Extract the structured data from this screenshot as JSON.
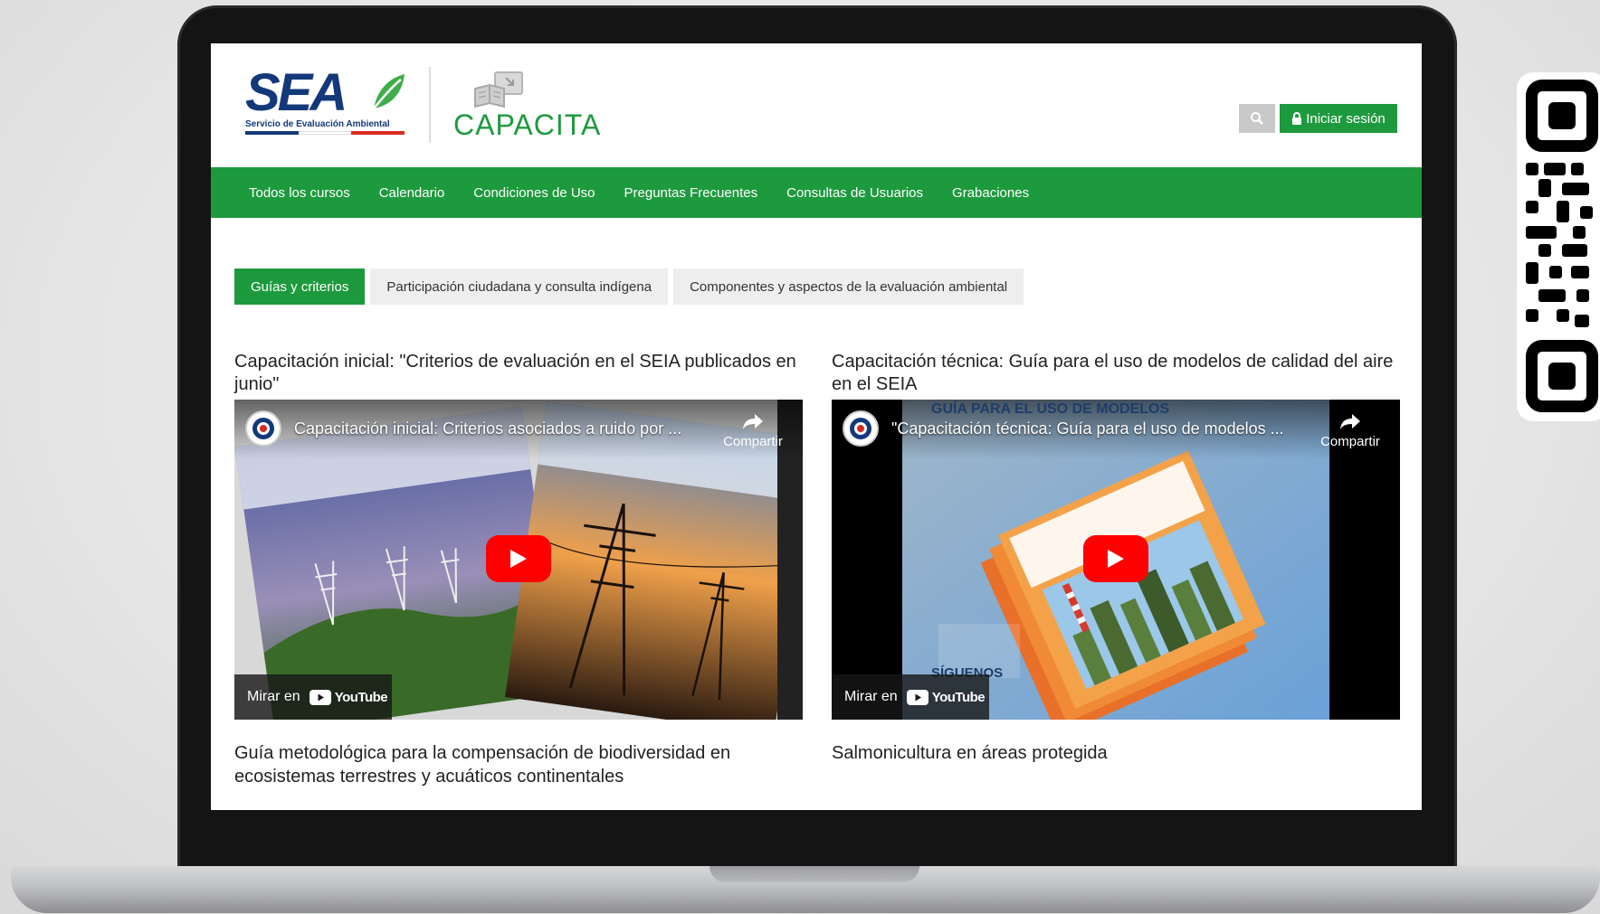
{
  "header": {
    "sea_logo_text": "SEA",
    "sea_subtitle": "Servicio de Evaluación Ambiental",
    "sea_stripe_colors": [
      "#13397a",
      "#ffffff",
      "#d52b1e"
    ],
    "app_name": "CAPACITA",
    "search_icon": "search-icon",
    "login_label": "Iniciar sesión",
    "login_icon": "lock-icon"
  },
  "nav": {
    "items": [
      {
        "label": "Todos los cursos"
      },
      {
        "label": "Calendario"
      },
      {
        "label": "Condiciones de Uso"
      },
      {
        "label": "Preguntas Frecuentes"
      },
      {
        "label": "Consultas de Usuarios"
      },
      {
        "label": "Grabaciones"
      }
    ]
  },
  "tabs": {
    "items": [
      {
        "label": "Guías y criterios",
        "active": true
      },
      {
        "label": "Participación ciudadana y consulta indígena",
        "active": false
      },
      {
        "label": "Componentes y aspectos de la evaluación ambiental",
        "active": false
      }
    ]
  },
  "courses": [
    {
      "title": "Capacitación inicial: \"Criterios de evaluación en el SEIA publicados en junio\"",
      "video_title": "Capacitación inicial: Criterios asociados a ruido por ...",
      "share_label": "Compartir",
      "watch_label": "Mirar en",
      "yt_label": "YouTube"
    },
    {
      "title": "Capacitación técnica: Guía para el uso de modelos de calidad del aire en el SEIA",
      "video_title": "\"Capacitación técnica: Guía para el uso de modelos ...",
      "share_label": "Compartir",
      "watch_label": "Mirar en",
      "yt_label": "YouTube",
      "thumb_heading": "GUÍA PARA EL USO DE MODELOS",
      "thumb_follow": "SÍGUENOS"
    }
  ],
  "bottom_courses": [
    {
      "title": "Guía metodológica para la compensación de biodiversidad en ecosistemas terrestres y acuáticos continentales"
    },
    {
      "title": "Salmonicultura en áreas protegida"
    }
  ],
  "colors": {
    "brand_green": "#1e9a3e",
    "sea_blue": "#13397a",
    "youtube_red": "#ff0000"
  }
}
